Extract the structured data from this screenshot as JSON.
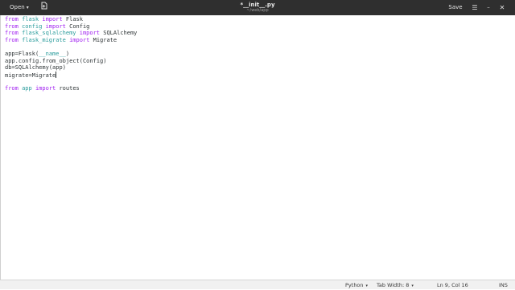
{
  "header": {
    "open_label": "Open",
    "open_caret": "▾",
    "newtab_icon": "new-document-icon",
    "title": "*__init__.py",
    "subtitle": "~/web/app",
    "save_label": "Save",
    "menu_icon": "☰",
    "minimize_icon": "–",
    "close_icon": "✕"
  },
  "editor": {
    "lines": [
      "from flask import Flask",
      "from config import Config",
      "from flask_sqlalchemy import SQLAlchemy",
      "from flask_migrate import Migrate",
      "",
      "app=Flask(__name__)",
      "app.config.from_object(Config)",
      "db=SQLAlchemy(app)",
      "migrate=Migrate",
      "",
      "from app import routes"
    ],
    "cursor": {
      "line": 9,
      "col": 16
    }
  },
  "statusbar": {
    "language": "Python",
    "tab_width": "Tab Width: 8",
    "position": "Ln 9, Col 16",
    "mode": "INS",
    "caret": "▾"
  },
  "colors": {
    "keyword": "#a020f0",
    "module": "#2a9c9c",
    "text": "#2e3436",
    "headerbar": "#2f2f2f"
  }
}
